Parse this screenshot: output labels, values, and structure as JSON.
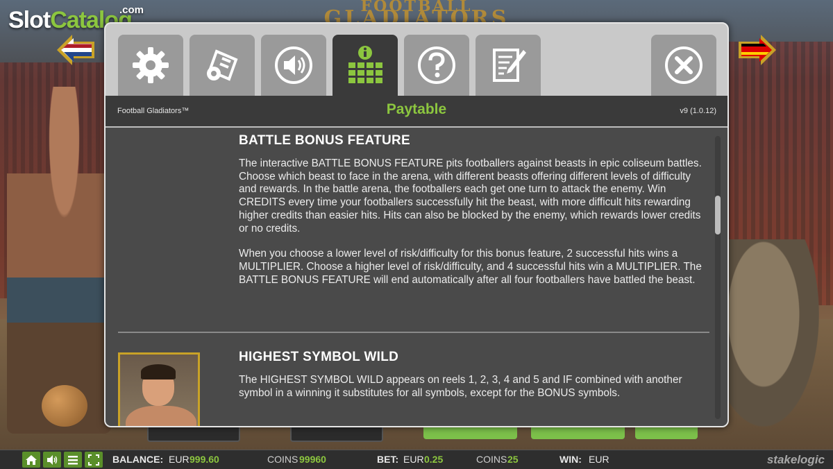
{
  "watermark": {
    "slot": "Slot",
    "catalog": "Catalog",
    "com": ".com"
  },
  "background_title": {
    "line1": "FOOTBALL",
    "line2": "GLADIATORS"
  },
  "tabs": [
    {
      "icon": "gear-icon",
      "active": false
    },
    {
      "icon": "settings-ticket-icon",
      "active": false
    },
    {
      "icon": "speaker-icon",
      "active": false
    },
    {
      "icon": "paytable-icon",
      "active": true
    },
    {
      "icon": "help-icon",
      "active": false
    },
    {
      "icon": "notes-icon",
      "active": false
    }
  ],
  "close_icon": "close-icon",
  "header": {
    "game_name": "Football Gladiators™",
    "title": "Paytable",
    "version": "v9 (1.0.12)"
  },
  "sections": {
    "battle": {
      "heading": "BATTLE BONUS FEATURE",
      "p1": "The interactive BATTLE BONUS FEATURE pits footballers against beasts in epic coliseum battles. Choose which beast to face in the arena, with different beasts offering different levels of difficulty and rewards. In the battle arena, the footballers each get one turn to attack the enemy. Win CREDITS every time your footballers successfully hit the beast, with more difficult hits rewarding higher credits than easier hits. Hits can also be blocked by the enemy, which rewards lower credits or no credits.",
      "p2": "When you choose a lower level of risk/difficulty for this bonus feature, 2 successful hits wins a MULTIPLIER. Choose a higher level of risk/difficulty, and 4 successful hits win a MULTIPLIER. The BATTLE BONUS FEATURE will end automatically after all four footballers have battled the beast."
    },
    "wild": {
      "heading": "HIGHEST SYMBOL WILD",
      "p1": "The HIGHEST SYMBOL WILD appears on reels 1, 2, 3, 4 and 5 and IF combined with another symbol in a winning it substitutes for all symbols, except for the BONUS symbols."
    }
  },
  "statusbar": {
    "buttons": [
      "home-icon",
      "sound-icon",
      "menu-icon",
      "fullscreen-icon"
    ],
    "balance_label": "BALANCE:",
    "balance_currency": "EUR",
    "balance_value": "999.60",
    "balance_coins_label": "COINS",
    "balance_coins_value": "99960",
    "bet_label": "BET:",
    "bet_currency": "EUR",
    "bet_value": "0.25",
    "bet_coins_label": "COINS",
    "bet_coins_value": "25",
    "win_label": "WIN:",
    "win_currency": "EUR",
    "brand": "stakelogic"
  },
  "colors": {
    "accent": "#8cc63f",
    "panel": "#4a4a4a",
    "tab": "#9a9a9a"
  }
}
